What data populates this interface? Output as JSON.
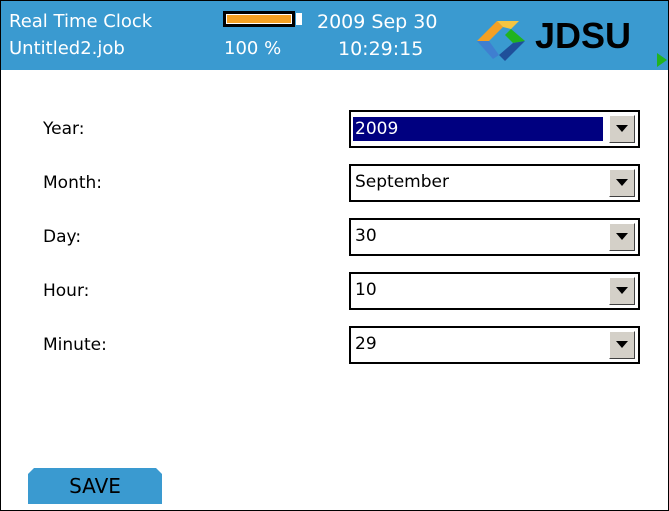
{
  "header": {
    "title": "Real Time Clock",
    "filename": "Untitled2.job",
    "battery_percent_label": "100 %",
    "battery_level": 1.0,
    "date": "2009 Sep 30",
    "time": "10:29:15",
    "brand": "JDSU",
    "brand_colors": [
      "#f4a023",
      "#21b31e",
      "#3a9ad0",
      "#1f4f9a"
    ],
    "header_color": "#3a9ad0",
    "battery_color": "#f4a023"
  },
  "form": {
    "fields": [
      {
        "label": "Year:",
        "value": "2009",
        "active": true
      },
      {
        "label": "Month:",
        "value": "September",
        "active": false
      },
      {
        "label": "Day:",
        "value": "30",
        "active": false
      },
      {
        "label": "Hour:",
        "value": "10",
        "active": false
      },
      {
        "label": "Minute:",
        "value": "29",
        "active": false
      }
    ],
    "dropdown_icon": "chevron-down-icon"
  },
  "footer": {
    "save_label": "SAVE"
  }
}
